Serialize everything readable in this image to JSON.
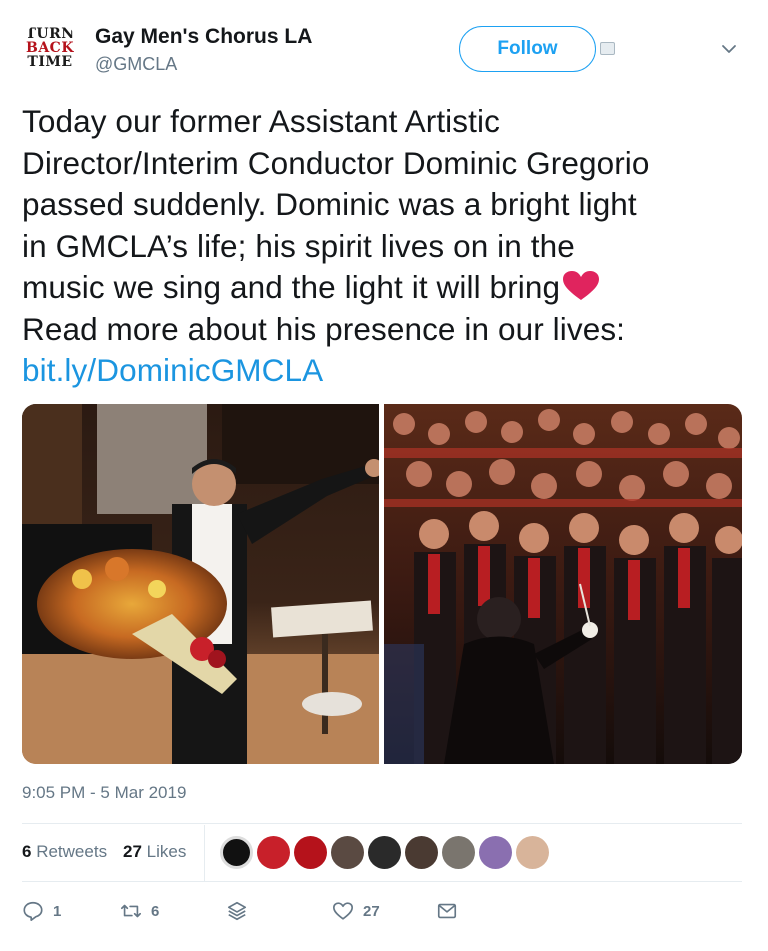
{
  "account": {
    "name": "Gay Men's Chorus LA",
    "handle": "@GMCLA",
    "avatar_lines": [
      "TURN",
      "BACK",
      "TIME"
    ]
  },
  "buttons": {
    "follow_label": "Follow"
  },
  "icons": {
    "dm": "direct-message-icon",
    "caret": "chevron-down-icon",
    "reply": "reply-icon",
    "retweet": "retweet-icon",
    "like": "heart-outline-icon",
    "dm_share": "envelope-icon",
    "stack": "layers-icon",
    "emoji": "red-heart-emoji"
  },
  "tweet": {
    "lines": [
      "Today our former Assistant Artistic",
      "Director/Interim Conductor Dominic Gregorio",
      "passed suddenly. Dominic was a bright light",
      "in GMCLA’s life; his spirit lives on in the",
      "music we sing and the light it will bring",
      "Read more about his presence in our lives:"
    ],
    "link": "bit.ly/DominicGMCLA",
    "timestamp": "9:05 PM - 5 Mar 2019"
  },
  "stats": {
    "retweets_count": "6",
    "retweets_label": "Retweets",
    "likes_count": "27",
    "likes_label": "Likes"
  },
  "actions": {
    "reply_count": "1",
    "retweet_count": "6",
    "like_count": "27"
  },
  "colors": {
    "accent": "#1da1f2",
    "link": "#1b95e0",
    "muted": "#657786",
    "heart": "#e0245e"
  }
}
